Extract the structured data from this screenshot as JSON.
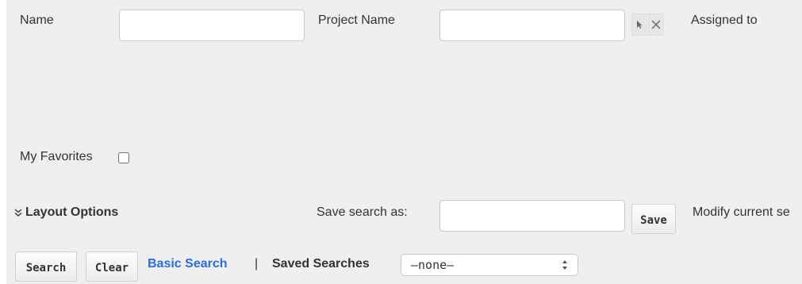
{
  "fields": {
    "name_label": "Name",
    "name_value": "",
    "project_name_label": "Project Name",
    "project_name_value": "",
    "assigned_to_label": "Assigned to"
  },
  "favorites": {
    "label": "My Favorites",
    "checked": false
  },
  "layout": {
    "toggle_label": "Layout Options",
    "save_search_label": "Save search as:",
    "save_search_value": "",
    "save_button": "Save",
    "modify_label": "Modify current se"
  },
  "footer": {
    "search_button": "Search",
    "clear_button": "Clear",
    "basic_search_link": "Basic Search",
    "separator": "|",
    "saved_searches_label": "Saved Searches",
    "saved_searches_selected": "–none–"
  },
  "icons": {
    "select": "arrow-cursor-icon",
    "clear": "close-x-icon",
    "layout_toggle": "double-chevron-down-icon",
    "dropdown": "up-down-arrows-icon"
  },
  "colors": {
    "panel_background": "#efefef",
    "link": "#2a6de0",
    "text": "#333333"
  }
}
